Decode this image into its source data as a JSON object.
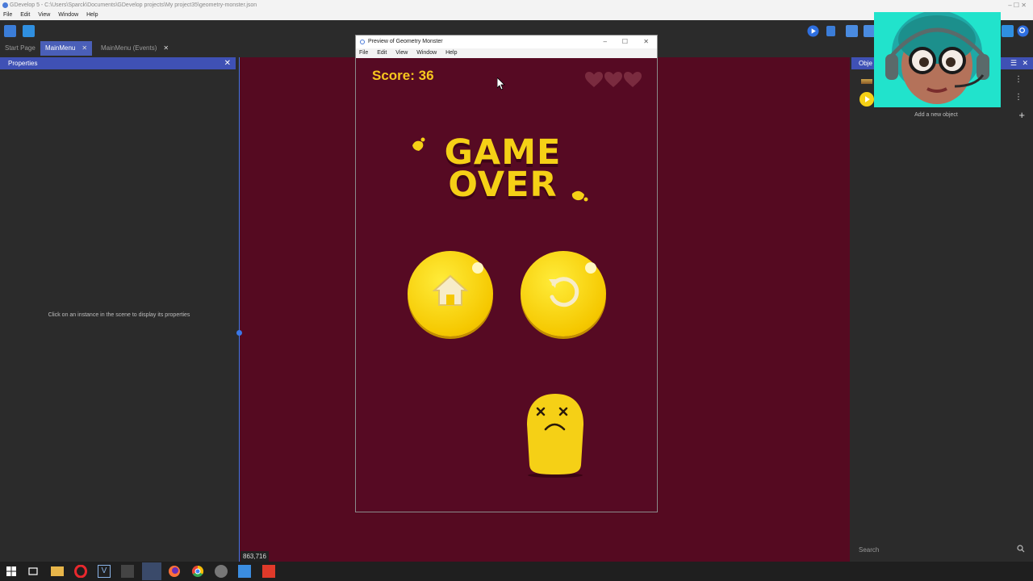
{
  "window": {
    "title": "GDevelop 5 - C:\\Users\\Sparck\\Documents\\GDevelop projects\\My project35\\geometry-monster.json",
    "controls": "–  ☐  ✕"
  },
  "menubar": {
    "items": [
      "File",
      "Edit",
      "View",
      "Window",
      "Help"
    ]
  },
  "tabs": [
    {
      "label": "Start Page"
    },
    {
      "label": "MainMenu",
      "active": true,
      "close": "✕"
    },
    {
      "label": "MainMenu (Events)",
      "close": "✕"
    }
  ],
  "properties_panel": {
    "title": "Properties",
    "hint": "Click on an instance in the scene to display its properties"
  },
  "scene": {
    "cursor_coords": "863,716"
  },
  "objects_panel": {
    "title": "Obje",
    "add_label": "Add a new object",
    "search_placeholder": "Search"
  },
  "preview": {
    "title": "Preview of Geometry Monster",
    "menu": [
      "File",
      "Edit",
      "View",
      "Window",
      "Help"
    ],
    "score_text": "Score: 36",
    "game_over_line1": "GAME",
    "game_over_line2": "OVER",
    "lives_remaining": 0,
    "lives_total": 3
  },
  "colors": {
    "accent_blue": "#3f51b5",
    "scene_bg": "#550a21",
    "game_yellow": "#f5d016",
    "heart_empty": "#7a2b3f"
  },
  "icons": {
    "home": "home-icon",
    "restart": "restart-icon"
  }
}
